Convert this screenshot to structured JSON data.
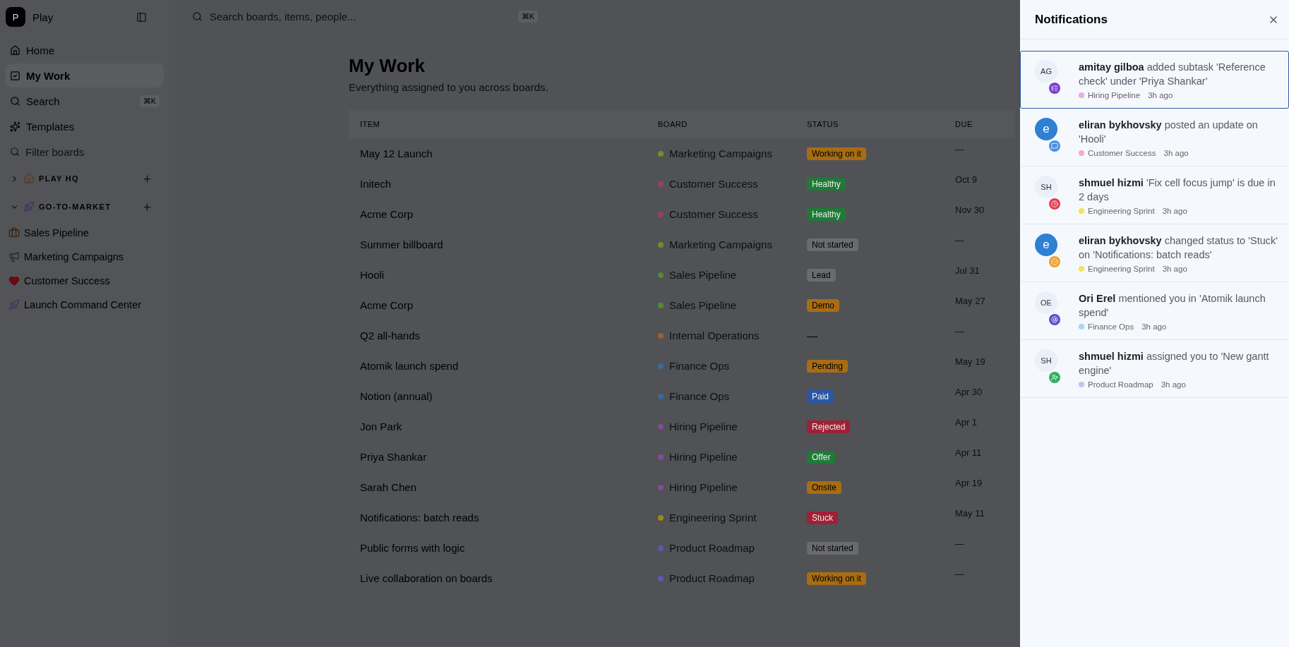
{
  "app": {
    "logo": "P",
    "name": "Play"
  },
  "nav": [
    {
      "label": "Home",
      "selected": false
    },
    {
      "label": "My Work",
      "selected": true
    },
    {
      "label": "Search",
      "selected": false,
      "shortcut": "⌘K"
    },
    {
      "label": "Templates",
      "selected": false
    }
  ],
  "filter": {
    "placeholder": "Filter boards"
  },
  "workspaces": [
    {
      "name": "PLAY HQ",
      "expanded": false
    },
    {
      "name": "GO-TO-MARKET",
      "expanded": true,
      "boards": [
        {
          "name": "Sales Pipeline"
        },
        {
          "name": "Marketing Campaigns"
        },
        {
          "name": "Customer Success"
        },
        {
          "name": "Launch Command Center"
        }
      ]
    }
  ],
  "search": {
    "placeholder": "Search boards, items, people...",
    "shortcut": "⌘K"
  },
  "page": {
    "title": "My Work",
    "subtitle": "Everything assigned to you across boards."
  },
  "table": {
    "columns": [
      "ITEM",
      "BOARD",
      "STATUS",
      "DUE"
    ],
    "rows": [
      {
        "item": "May 12 Launch",
        "board": {
          "name": "Marketing Campaigns",
          "color": "#7a8a2a"
        },
        "status": {
          "label": "Working on it",
          "color": "#a86d12"
        },
        "due": "—"
      },
      {
        "item": "Initech",
        "board": {
          "name": "Customer Success",
          "color": "#9a4060"
        },
        "status": {
          "label": "Healthy",
          "color": "#1f7a38"
        },
        "due": "Oct 9"
      },
      {
        "item": "Acme Corp",
        "board": {
          "name": "Customer Success",
          "color": "#9a4060"
        },
        "status": {
          "label": "Healthy",
          "color": "#1f7a38"
        },
        "due": "Nov 30"
      },
      {
        "item": "Summer billboard",
        "board": {
          "name": "Marketing Campaigns",
          "color": "#7a8a2a"
        },
        "status": {
          "label": "Not started",
          "color": "#6a6b6e"
        },
        "due": "—"
      },
      {
        "item": "Hooli",
        "board": {
          "name": "Sales Pipeline",
          "color": "#4f8a34"
        },
        "status": {
          "label": "Lead",
          "color": "#6a6b6e"
        },
        "due": "Jul 31"
      },
      {
        "item": "Acme Corp",
        "board": {
          "name": "Sales Pipeline",
          "color": "#4f8a34"
        },
        "status": {
          "label": "Demo",
          "color": "#a86d12"
        },
        "due": "May 27"
      },
      {
        "item": "Q2 all-hands",
        "board": {
          "name": "Internal Operations",
          "color": "#9a6035"
        },
        "status": {
          "label": "—"
        },
        "due": "—"
      },
      {
        "item": "Atomik launch spend",
        "board": {
          "name": "Finance Ops",
          "color": "#3a6a9a"
        },
        "status": {
          "label": "Pending",
          "color": "#a86d12"
        },
        "due": "May 19"
      },
      {
        "item": "Notion (annual)",
        "board": {
          "name": "Finance Ops",
          "color": "#3a6a9a"
        },
        "status": {
          "label": "Paid",
          "color": "#2a56a8"
        },
        "due": "Apr 30"
      },
      {
        "item": "Jon Park",
        "board": {
          "name": "Hiring Pipeline",
          "color": "#844a9c"
        },
        "status": {
          "label": "Rejected",
          "color": "#a02035"
        },
        "due": "Apr 1"
      },
      {
        "item": "Priya Shankar",
        "board": {
          "name": "Hiring Pipeline",
          "color": "#844a9c"
        },
        "status": {
          "label": "Offer",
          "color": "#1f7a38"
        },
        "due": "Apr 11"
      },
      {
        "item": "Sarah Chen",
        "board": {
          "name": "Hiring Pipeline",
          "color": "#844a9c"
        },
        "status": {
          "label": "Onsite",
          "color": "#a86d12"
        },
        "due": "Apr 19"
      },
      {
        "item": "Notifications: batch reads",
        "board": {
          "name": "Engineering Sprint",
          "color": "#9a8a1a"
        },
        "status": {
          "label": "Stuck",
          "color": "#a02035"
        },
        "due": "May 11"
      },
      {
        "item": "Public forms with logic",
        "board": {
          "name": "Product Roadmap",
          "color": "#5e58a8"
        },
        "status": {
          "label": "Not started",
          "color": "#6a6b6e"
        },
        "due": "—"
      },
      {
        "item": "Live collaboration on boards",
        "board": {
          "name": "Product Roadmap",
          "color": "#5e58a8"
        },
        "status": {
          "label": "Working on it",
          "color": "#a86d12"
        },
        "due": "—"
      }
    ]
  },
  "notifications": {
    "title": "Notifications",
    "items": [
      {
        "avatar": "AG",
        "avatar_filled": false,
        "kind": "subtask",
        "actor": "amitay gilboa",
        "text": "added subtask 'Reference check' under 'Priya Shankar'",
        "board": {
          "name": "Hiring Pipeline",
          "color": "#e9a8f0"
        },
        "time": "3h ago",
        "selected": true
      },
      {
        "avatar": "e",
        "avatar_filled": true,
        "kind": "comment",
        "actor": "eliran bykhovsky",
        "text": "posted an update on 'Hooli'",
        "board": {
          "name": "Customer Success",
          "color": "#f7a8c4"
        },
        "time": "3h ago",
        "selected": false
      },
      {
        "avatar": "SH",
        "avatar_filled": false,
        "kind": "due",
        "actor": "shmuel hizmi",
        "text": "'Fix cell focus jump' is due in 2 days",
        "board": {
          "name": "Engineering Sprint",
          "color": "#f5e35a"
        },
        "time": "3h ago",
        "selected": false
      },
      {
        "avatar": "e",
        "avatar_filled": true,
        "kind": "status",
        "actor": "eliran bykhovsky",
        "text": "changed status to 'Stuck' on 'Notifications: batch reads'",
        "board": {
          "name": "Engineering Sprint",
          "color": "#f5e35a"
        },
        "time": "3h ago",
        "selected": false
      },
      {
        "avatar": "OE",
        "avatar_filled": false,
        "kind": "mention",
        "actor": "Ori Erel",
        "text": "mentioned you in 'Atomik launch spend'",
        "board": {
          "name": "Finance Ops",
          "color": "#a8d4f5"
        },
        "time": "3h ago",
        "selected": false
      },
      {
        "avatar": "SH",
        "avatar_filled": false,
        "kind": "assign",
        "actor": "shmuel hizmi",
        "text": "assigned you to 'New gantt engine'",
        "board": {
          "name": "Product Roadmap",
          "color": "#c8c0f0"
        },
        "time": "3h ago",
        "selected": false
      }
    ]
  }
}
